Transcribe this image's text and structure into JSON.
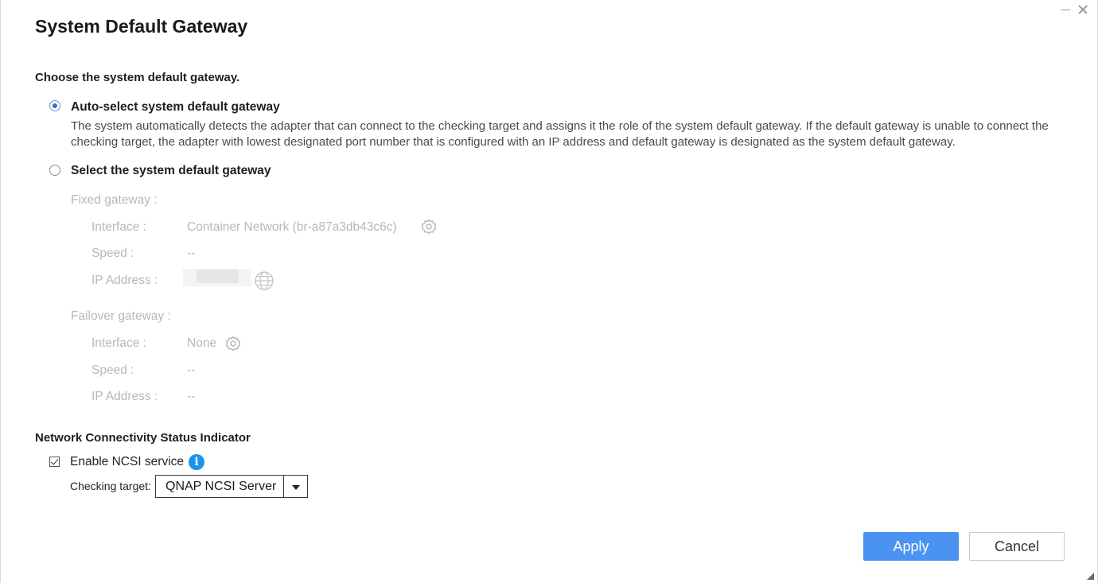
{
  "window": {
    "title": "System Default Gateway"
  },
  "gateway_section": {
    "heading": "Choose the system default gateway.",
    "auto_option": {
      "label": "Auto-select system default gateway",
      "selected": true,
      "description": "The system automatically detects the adapter that can connect to the checking target and assigns it the role of the system default gateway. If the default gateway is unable to connect the checking target, the adapter with lowest designated port number that is configured with an IP address and default gateway is designated as the system default gateway."
    },
    "manual_option": {
      "label": "Select the system default gateway",
      "selected": false
    },
    "fixed": {
      "heading": "Fixed gateway :",
      "interface_label": "Interface :",
      "interface_value": "Container Network (br-a87a3db43c6c)",
      "speed_label": "Speed :",
      "speed_value": "--",
      "ip_label": "IP Address :"
    },
    "failover": {
      "heading": "Failover gateway :",
      "interface_label": "Interface :",
      "interface_value": "None",
      "speed_label": "Speed :",
      "speed_value": "--",
      "ip_label": "IP Address :",
      "ip_value": "--"
    }
  },
  "ncsi": {
    "heading": "Network Connectivity Status Indicator",
    "enable_label": "Enable NCSI service",
    "enabled": true,
    "checking_target_label": "Checking target:",
    "checking_target_value": "QNAP NCSI Server"
  },
  "buttons": {
    "apply": "Apply",
    "cancel": "Cancel"
  },
  "colors": {
    "primary": "#4a93f0",
    "info": "#1a93e8",
    "disabled_text": "#b8b8b8"
  }
}
